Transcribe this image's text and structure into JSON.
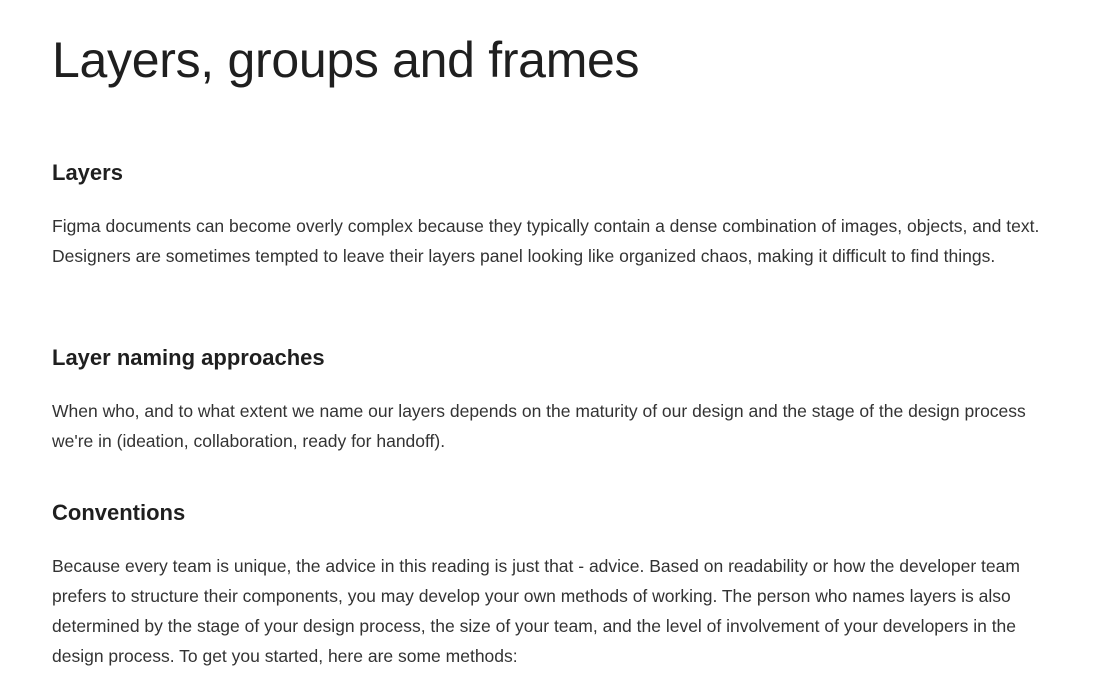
{
  "title": "Layers, groups and frames",
  "sections": [
    {
      "heading": "Layers",
      "body": "Figma documents can become overly complex because they typically contain a dense combination of images, objects, and text. Designers are sometimes tempted to leave their layers panel looking like organized chaos, making it difficult to find things."
    },
    {
      "heading": "Layer naming approaches",
      "body": "When who, and to what extent we name our layers depends on the maturity of our design and the stage of the design process we're in (ideation, collaboration, ready for handoff)."
    },
    {
      "heading": "Conventions",
      "body": "Because every team is unique, the advice in this reading is just that - advice. Based on readability or how the developer team prefers to structure their components, you may develop your own methods of working. The person who names layers is also determined by the stage of your design process, the size of your team, and the level of involvement of your developers in the design process. To get you started, here are some methods:"
    }
  ]
}
